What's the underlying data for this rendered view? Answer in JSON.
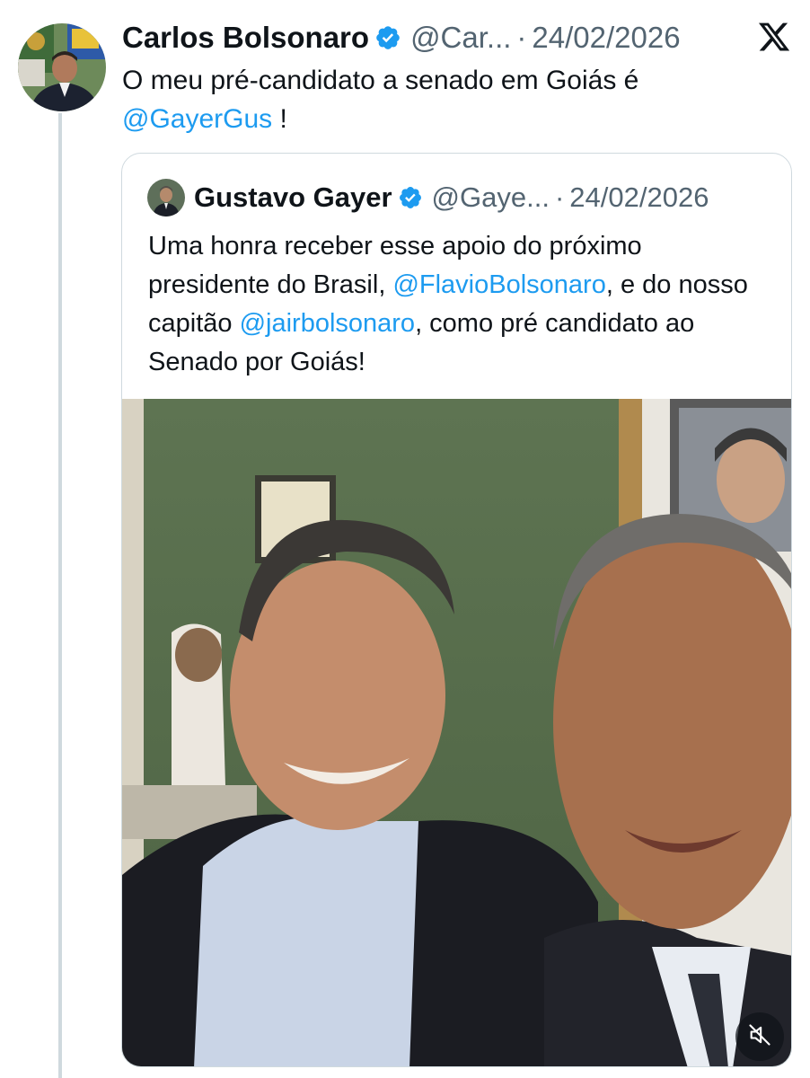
{
  "tweet": {
    "author_name": "Carlos Bolsonaro",
    "handle": "@Car...",
    "separator": "·",
    "date": "24/02/2026",
    "text_before": "O meu pré-candidato a senado em Goiás é",
    "mention": "@GayerGus",
    "text_after": " !"
  },
  "quoted_tweet": {
    "author_name": "Gustavo Gayer",
    "handle": "@Gaye...",
    "separator": "·",
    "date": "24/02/2026",
    "text_1": "Uma honra receber esse apoio do próximo presidente do Brasil, ",
    "mention_1": "@FlavioBolsonaro",
    "text_2": ", e do nosso capitão ",
    "mention_2": "@jairbolsonaro",
    "text_3": ", como pré candidato ao Senado por Goiás!"
  },
  "icons": {
    "verified": "verified-badge-icon",
    "platform": "x-logo-icon",
    "mute": "speaker-muted-icon"
  },
  "colors": {
    "link": "#1d9bf0",
    "verified": "#1d9bf0",
    "secondary_text": "#536471",
    "border": "#cfd9de"
  }
}
